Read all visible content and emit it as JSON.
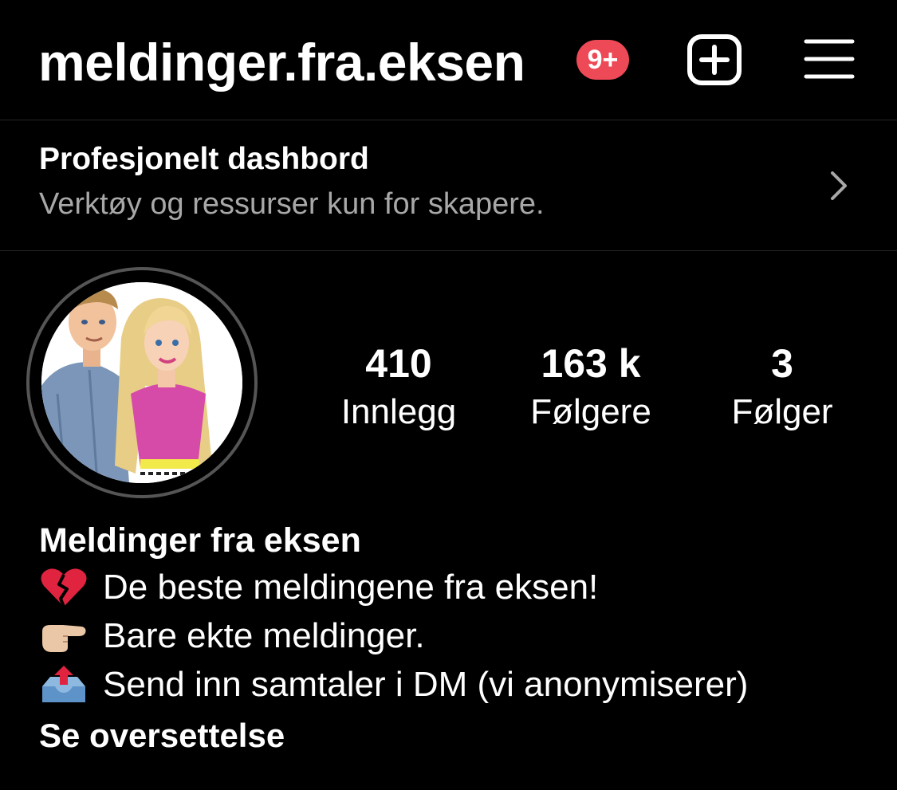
{
  "header": {
    "username": "meldinger.fra.eksen",
    "notification_badge": "9+",
    "badge_color": "#ed4956",
    "add_icon": "plus-square-icon",
    "menu_icon": "hamburger-menu-icon"
  },
  "dashboard": {
    "title": "Profesjonelt dashbord",
    "subtitle": "Verktøy og ressurser kun for skapere.",
    "chevron_icon": "chevron-right-icon"
  },
  "stats": [
    {
      "count": "410",
      "label": "Innlegg"
    },
    {
      "count": "163 k",
      "label": "Følgere"
    },
    {
      "count": "3",
      "label": "Følger"
    }
  ],
  "bio": {
    "name": "Meldinger fra eksen",
    "lines": [
      {
        "icon": "broken-heart-icon",
        "text": "De beste meldingene fra eksen!"
      },
      {
        "icon": "pointing-hand-icon",
        "text": "Bare ekte meldinger."
      },
      {
        "icon": "outbox-tray-icon",
        "text": "Send inn samtaler i DM (vi anonymiserer)"
      }
    ],
    "translate_label": "Se oversettelse"
  }
}
